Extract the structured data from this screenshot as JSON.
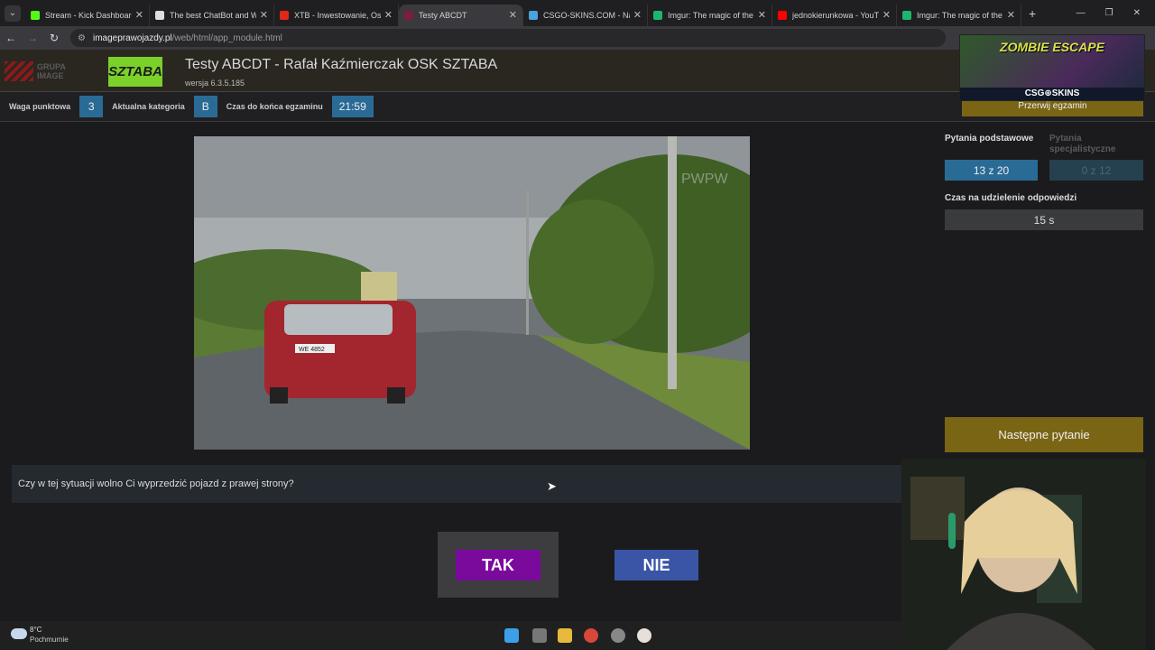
{
  "browser": {
    "tabs": [
      {
        "label": "Stream - Kick Dashboard",
        "color": "#53fc18"
      },
      {
        "label": "The best ChatBot and Wi",
        "color": "#dddddd"
      },
      {
        "label": "XTB - Inwestowanie, Oszc",
        "color": "#e1261c"
      },
      {
        "label": "Testy ABCDT",
        "color": "#7a1e3a",
        "active": true
      },
      {
        "label": "CSGO-SKINS.COM - Najle",
        "color": "#4aa3df"
      },
      {
        "label": "Imgur: The magic of the I",
        "color": "#1bb76e"
      },
      {
        "label": "jednokierunkowa - YouTu",
        "color": "#ff0000"
      },
      {
        "label": "Imgur: The magic of the I",
        "color": "#1bb76e"
      }
    ],
    "url_host": "imageprawojazdy.pl",
    "url_path": "/web/html/app_module.html"
  },
  "header": {
    "logo_grupa_line1": "GRUPA",
    "logo_grupa_line2": "IMAGE",
    "logo_sztaba": "SZTABA",
    "title": "Testy ABCDT - Rafał Kaźmierczak OSK SZTABA",
    "version": "wersja 6.3.5.185"
  },
  "overlay_ad": {
    "title": "ZOMBIE ESCAPE",
    "brand": "CSG⊕SKINS"
  },
  "infobar": {
    "waga_label": "Waga punktowa",
    "waga_value": "3",
    "kategoria_label": "Aktualna kategoria",
    "kategoria_value": "B",
    "czas_label": "Czas do końca egzaminu",
    "czas_value": "21:59",
    "przerwij_label": "Przerwij egzamin"
  },
  "media": {
    "watermark": "PWPW",
    "plate": "WE 4852"
  },
  "right_panel": {
    "podstawowe_label": "Pytania podstawowe",
    "podstawowe_value": "13 z 20",
    "specjalistyczne_label": "Pytania specjalistyczne",
    "specjalistyczne_value": "0 z 12",
    "czas_odp_label": "Czas na udzielenie odpowiedzi",
    "czas_odp_value": "15 s",
    "next_label": "Następne pytanie"
  },
  "question": {
    "text": "Czy w tej sytuacji wolno Ci wyprzedzić pojazd z prawej strony?"
  },
  "answers": {
    "tak": "TAK",
    "nie": "NIE"
  },
  "taskbar": {
    "temperature": "8°C",
    "weather": "Pochmurnie"
  },
  "colors": {
    "accent_blue": "#2a6b96",
    "gold": "#7a6514",
    "tak_purple": "#7a0a9c",
    "nie_blue": "#3a55a6"
  }
}
